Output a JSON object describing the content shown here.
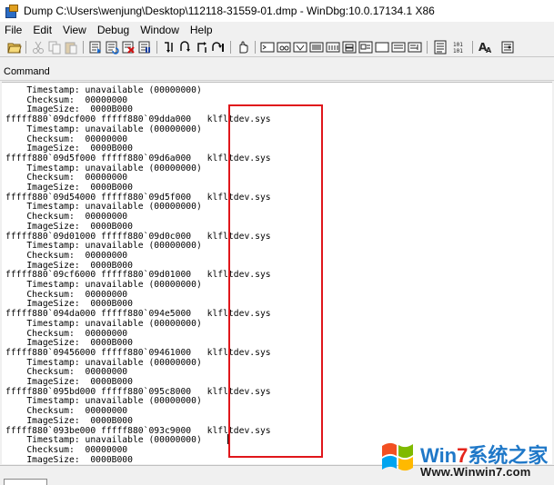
{
  "window": {
    "title": "Dump C:\\Users\\wenjung\\Desktop\\112118-31559-01.dmp - WinDbg:10.0.17134.1 X86"
  },
  "menu": [
    "File",
    "Edit",
    "View",
    "Debug",
    "Window",
    "Help"
  ],
  "toolbar": {
    "buttons": [
      {
        "name": "open-icon",
        "enabled": true
      },
      {
        "name": "cut-icon",
        "enabled": false
      },
      {
        "name": "copy-icon",
        "enabled": false
      },
      {
        "name": "paste-icon",
        "enabled": false
      },
      {
        "name": "go-icon",
        "enabled": true
      },
      {
        "name": "restart-icon",
        "enabled": true
      },
      {
        "name": "stop-debugging-icon",
        "enabled": true
      },
      {
        "name": "break-icon",
        "enabled": true
      },
      {
        "name": "step-into-icon",
        "enabled": true
      },
      {
        "name": "step-over-icon",
        "enabled": true
      },
      {
        "name": "step-out-icon",
        "enabled": true
      },
      {
        "name": "run-to-cursor-icon",
        "enabled": true
      },
      {
        "name": "breakpoint-hand-icon",
        "enabled": true
      },
      {
        "name": "command-window-icon",
        "enabled": true
      },
      {
        "name": "watch-window-icon",
        "enabled": true
      },
      {
        "name": "locals-window-icon",
        "enabled": true
      },
      {
        "name": "registers-window-icon",
        "enabled": true
      },
      {
        "name": "memory-window-icon",
        "enabled": true
      },
      {
        "name": "call-stack-window-icon",
        "enabled": true
      },
      {
        "name": "disassembly-window-icon",
        "enabled": true
      },
      {
        "name": "scratch-pad-icon",
        "enabled": true
      },
      {
        "name": "processes-threads-icon",
        "enabled": true
      },
      {
        "name": "source-mode-icon",
        "enabled": true
      },
      {
        "name": "binary-hex-icon",
        "enabled": true
      },
      {
        "name": "font-icon",
        "enabled": true
      },
      {
        "name": "options-icon",
        "enabled": true
      }
    ],
    "font_label": "A"
  },
  "command_pane": {
    "title": "Command",
    "lines": [
      "    Timestamp: unavailable (00000000)",
      "    Checksum:  00000000",
      "    ImageSize:  0000B000",
      "fffff880`09dcf000 fffff880`09dda000   klfltdev.sys",
      "    Timestamp: unavailable (00000000)",
      "    Checksum:  00000000",
      "    ImageSize:  0000B000",
      "fffff880`09d5f000 fffff880`09d6a000   klfltdev.sys",
      "    Timestamp: unavailable (00000000)",
      "    Checksum:  00000000",
      "    ImageSize:  0000B000",
      "fffff880`09d54000 fffff880`09d5f000   klfltdev.sys",
      "    Timestamp: unavailable (00000000)",
      "    Checksum:  00000000",
      "    ImageSize:  0000B000",
      "fffff880`09d01000 fffff880`09d0c000   klfltdev.sys",
      "    Timestamp: unavailable (00000000)",
      "    Checksum:  00000000",
      "    ImageSize:  0000B000",
      "fffff880`09cf6000 fffff880`09d01000   klfltdev.sys",
      "    Timestamp: unavailable (00000000)",
      "    Checksum:  00000000",
      "    ImageSize:  0000B000",
      "fffff880`094da000 fffff880`094e5000   klfltdev.sys",
      "    Timestamp: unavailable (00000000)",
      "    Checksum:  00000000",
      "    ImageSize:  0000B000",
      "fffff880`09456000 fffff880`09461000   klfltdev.sys",
      "    Timestamp: unavailable (00000000)",
      "    Checksum:  00000000",
      "    ImageSize:  0000B000",
      "fffff880`095bd000 fffff880`095c8000   klfltdev.sys",
      "    Timestamp: unavailable (00000000)",
      "    Checksum:  00000000",
      "    ImageSize:  0000B000",
      "fffff880`093be000 fffff880`093c9000   klfltdev.sys",
      "    Timestamp: unavailable (00000000)",
      "    Checksum:  00000000",
      "    ImageSize:  0000B000"
    ]
  },
  "watermark": {
    "brand_prefix": "Win",
    "brand_seven": "7",
    "brand_suffix": "系统之家",
    "url": "Www.Winwin7.com"
  },
  "colors": {
    "highlight_box": "#e0161b",
    "watermark_blue": "#1f78c8",
    "watermark_red": "#e5251b"
  }
}
